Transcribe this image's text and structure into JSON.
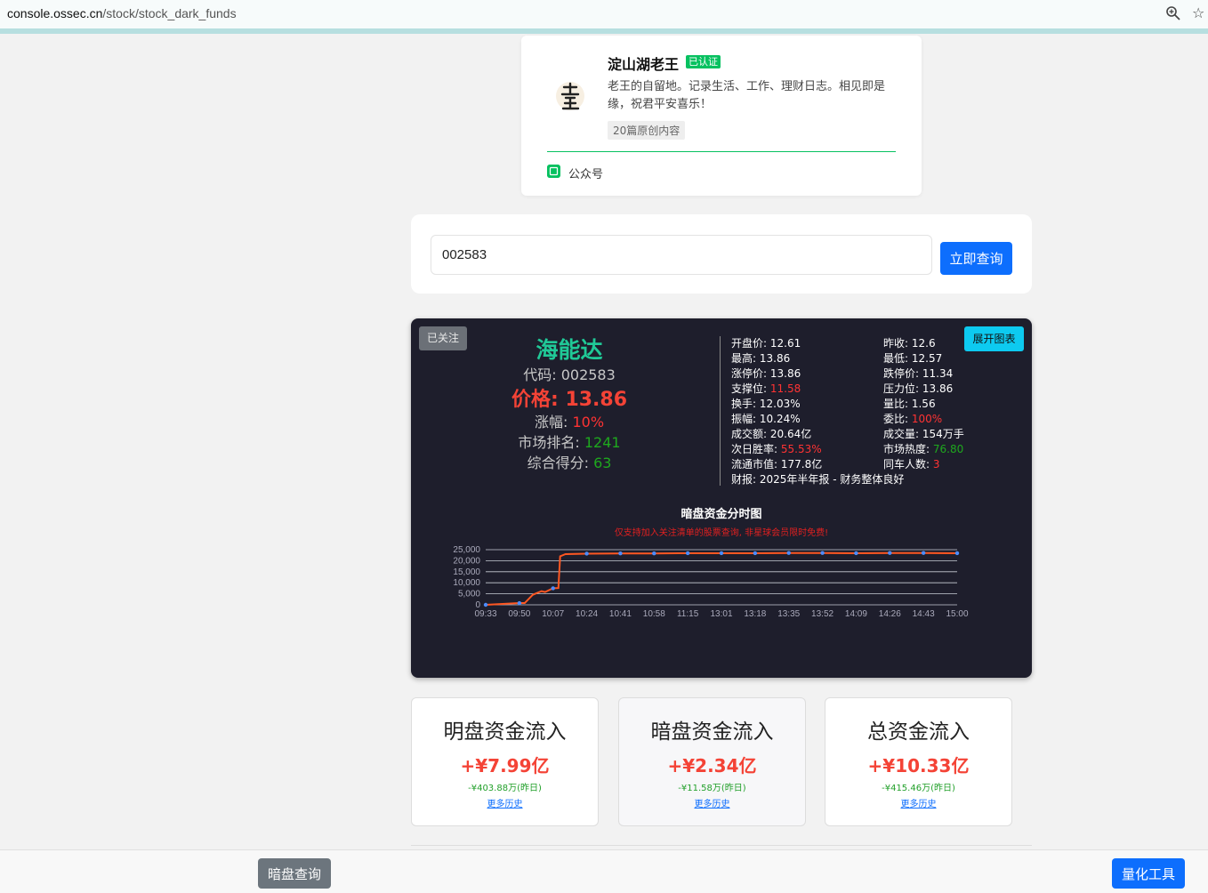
{
  "browser": {
    "url_host": "console.ossec.cn",
    "url_path": "/stock/stock_dark_funds"
  },
  "author": {
    "name": "淀山湖老王",
    "verified": "已认证",
    "desc": "老王的自留地。记录生活、工作、理财日志。相见即是缘，祝君平安喜乐！",
    "tag": "20篇原创内容",
    "gzh": "公众号"
  },
  "search": {
    "value": "002583",
    "button": "立即查询"
  },
  "stock": {
    "followed": "已关注",
    "expand": "展开图表",
    "name": "海能达",
    "code_label": "代码: ",
    "code": "002583",
    "price_label": "价格: ",
    "price": "13.86",
    "change_label": "涨幅: ",
    "change": "10%",
    "rank_label": "市场排名: ",
    "rank": "1241",
    "score_label": "综合得分: ",
    "score": "63",
    "left_stats": [
      {
        "label": "开盘价: ",
        "value": "12.61",
        "color": ""
      },
      {
        "label": "最高: ",
        "value": "13.86",
        "color": ""
      },
      {
        "label": "涨停价: ",
        "value": "13.86",
        "color": ""
      },
      {
        "label": "支撑位: ",
        "value": "11.58",
        "color": "red"
      },
      {
        "label": "换手: ",
        "value": "12.03%",
        "color": ""
      },
      {
        "label": "振幅: ",
        "value": "10.24%",
        "color": ""
      },
      {
        "label": "成交额: ",
        "value": "20.64亿",
        "color": ""
      },
      {
        "label": "次日胜率: ",
        "value": "55.53%",
        "color": "red"
      },
      {
        "label": "流通市值: ",
        "value": "177.8亿",
        "color": ""
      },
      {
        "label": "财报: ",
        "value": "2025年半年报 - 财务整体良好",
        "color": ""
      }
    ],
    "right_stats": [
      {
        "label": "昨收: ",
        "value": "12.6",
        "color": ""
      },
      {
        "label": "最低: ",
        "value": "12.57",
        "color": ""
      },
      {
        "label": "跌停价: ",
        "value": "11.34",
        "color": ""
      },
      {
        "label": "压力位: ",
        "value": "13.86",
        "color": ""
      },
      {
        "label": "量比: ",
        "value": "1.56",
        "color": ""
      },
      {
        "label": "委比: ",
        "value": "100%",
        "color": "red"
      },
      {
        "label": "成交量: ",
        "value": "154万手",
        "color": ""
      },
      {
        "label": "市场热度: ",
        "value": "76.80",
        "color": "green"
      },
      {
        "label": "同车人数: ",
        "value": "3",
        "color": "red"
      }
    ]
  },
  "chart_data": {
    "type": "line",
    "title": "暗盘资金分时图",
    "note": "仅支持加入关注清单的股票查询, 非星球会员限时免费!",
    "ylim": [
      0,
      25000
    ],
    "yticks": [
      "25,000",
      "20,000",
      "15,000",
      "10,000",
      "5,000",
      "0"
    ],
    "ytick_values": [
      25000,
      20000,
      15000,
      10000,
      5000,
      0
    ],
    "categories": [
      "09:33",
      "09:50",
      "10:07",
      "10:24",
      "10:41",
      "10:58",
      "11:15",
      "13:01",
      "13:18",
      "13:35",
      "13:52",
      "14:09",
      "14:26",
      "14:43",
      "15:00"
    ],
    "series": [
      {
        "values": [
          0,
          800,
          7500,
          23200,
          23300,
          23300,
          23400,
          23400,
          23400,
          23500,
          23500,
          23400,
          23500,
          23500,
          23400
        ]
      }
    ],
    "line_color": "#ff5722",
    "point_color": "#4d8cff",
    "grid": true
  },
  "flows": [
    {
      "title": "明盘资金流入",
      "value": "+¥7.99亿",
      "prev": "-¥403.88万(昨日)",
      "link": "更多历史"
    },
    {
      "title": "暗盘资金流入",
      "value": "+¥2.34亿",
      "prev": "-¥11.58万(昨日)",
      "link": "更多历史"
    },
    {
      "title": "总资金流入",
      "value": "+¥10.33亿",
      "prev": "-¥415.46万(昨日)",
      "link": "更多历史"
    }
  ],
  "bottom": {
    "dark_query": "暗盘查询",
    "quant_tools": "量化工具"
  }
}
